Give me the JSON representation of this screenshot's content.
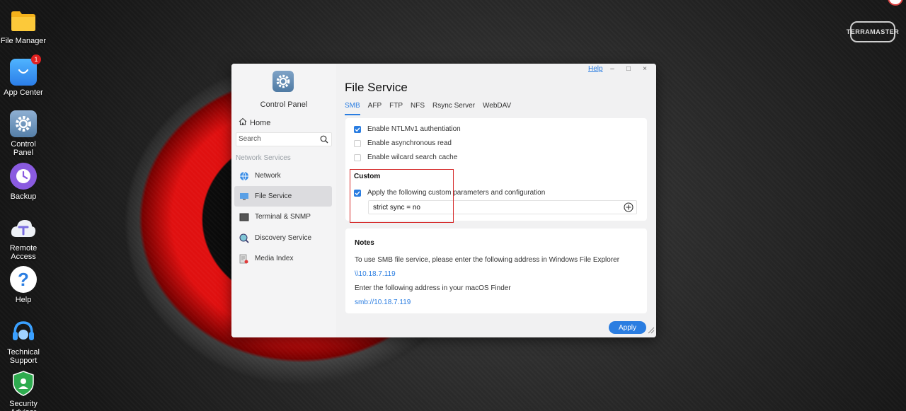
{
  "desktop": {
    "icons": [
      {
        "label": "File Manager",
        "icon": "folder-icon"
      },
      {
        "label": "App Center",
        "icon": "shopping-bag-icon",
        "badge": "1"
      },
      {
        "label": "Control Panel",
        "icon": "gear-icon"
      },
      {
        "label": "Backup",
        "icon": "clock-icon"
      },
      {
        "label": "Remote Access",
        "icon": "cloud-icon"
      },
      {
        "label": "Help",
        "icon": "question-icon"
      },
      {
        "label": "Technical Support",
        "icon": "headset-icon"
      },
      {
        "label": "Security Advisor",
        "icon": "shield-icon"
      }
    ],
    "brand_logo": "TERRAMASTER"
  },
  "window": {
    "app_title": "Control Panel",
    "help_label": "Help",
    "controls": {
      "minimize": "–",
      "maximize": "□",
      "close": "×"
    },
    "sidebar": {
      "home_label": "Home",
      "search_placeholder": "Search",
      "section_label": "Network Services",
      "items": [
        {
          "label": "Network",
          "icon": "globe-icon",
          "active": false
        },
        {
          "label": "File Service",
          "icon": "monitor-icon",
          "active": true
        },
        {
          "label": "Terminal & SNMP",
          "icon": "terminal-icon",
          "active": false
        },
        {
          "label": "Discovery Service",
          "icon": "magnifier-icon",
          "active": false
        },
        {
          "label": "Media Index",
          "icon": "media-doc-icon",
          "active": false
        }
      ]
    },
    "main": {
      "page_title": "File Service",
      "tabs": [
        "SMB",
        "AFP",
        "FTP",
        "NFS",
        "Rsync Server",
        "WebDAV"
      ],
      "active_tab": "SMB",
      "options": [
        {
          "label": "Enable NTLMv1 authentiation",
          "checked": true
        },
        {
          "label": "Enable asynchronous read",
          "checked": false
        },
        {
          "label": "Enable wilcard search cache",
          "checked": false
        }
      ],
      "custom": {
        "heading": "Custom",
        "apply_label": "Apply the following custom parameters and configuration",
        "apply_checked": true,
        "param_value": "strict sync = no"
      },
      "notes": {
        "heading": "Notes",
        "windows_text": "To use SMB file service, please enter the following address in Windows File Explorer",
        "windows_address": "\\\\10.18.7.119",
        "mac_text": "Enter the following address in your macOS Finder",
        "mac_address": "smb://10.18.7.119"
      },
      "apply_button": "Apply"
    },
    "colors": {
      "accent": "#2a7de1",
      "highlight": "#d52a2a"
    }
  }
}
